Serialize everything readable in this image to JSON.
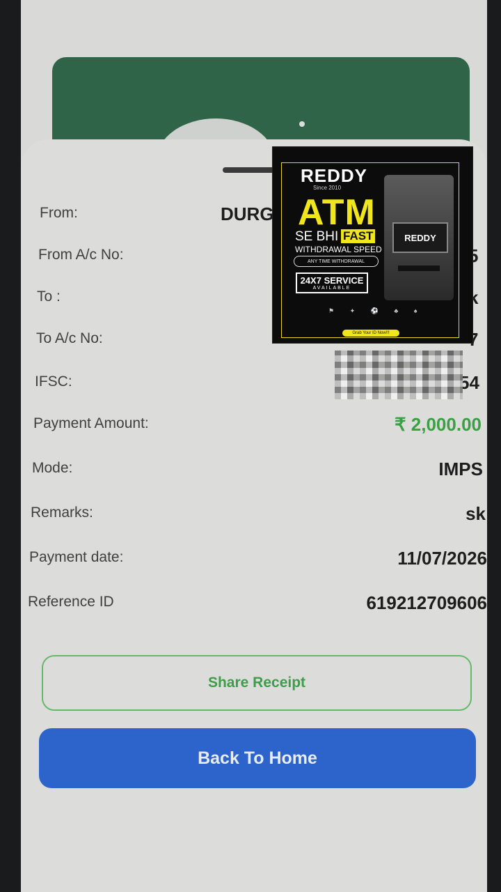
{
  "details": {
    "from_label": "From:",
    "from_value_partial": "DURG",
    "from_ac_label": "From A/c No:",
    "from_ac_value_partial": "5",
    "to_label": "To :",
    "to_value_partial": "k",
    "to_ac_label": "To A/c No:",
    "to_ac_value_partial": "7",
    "ifsc_label": "IFSC:",
    "ifsc_value_partial": "54",
    "amount_label": "Payment Amount:",
    "amount_value": "₹ 2,000.00",
    "mode_label": "Mode:",
    "mode_value": "IMPS",
    "remarks_label": "Remarks:",
    "remarks_value": "sk",
    "date_label": "Payment date:",
    "date_value": "11/07/2026",
    "ref_label": "Reference ID",
    "ref_value": "619212709606"
  },
  "actions": {
    "share_label": "Share Receipt",
    "home_label": "Back To Home"
  },
  "ad": {
    "brand": "REDDY",
    "brand_sub": "Since 2010",
    "headline": "ATM",
    "line1": "SE BHI",
    "fast": "FAST",
    "line2": "WITHDRAWAL SPEED",
    "pill": "ANY TIME WITHDRAWAL",
    "service": "24X7 SERVICE",
    "service_sub": "AVAILABLE",
    "machine_brand": "REDDY",
    "cta": "Grab Your ID Now!!!"
  },
  "colors": {
    "amount_green": "#3aa043",
    "primary_blue": "#2c64cc",
    "header_green": "#2f6448",
    "ad_yellow": "#f1e61c"
  }
}
